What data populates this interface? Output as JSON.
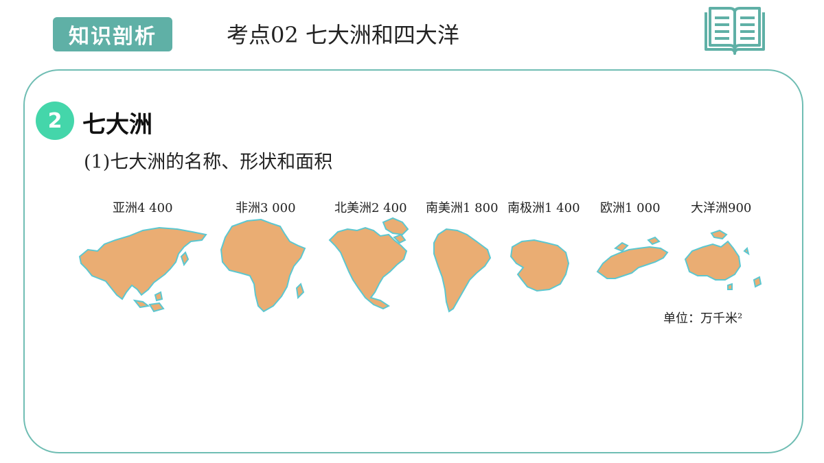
{
  "header": {
    "badge": "知识剖析",
    "title": "考点02  七大洲和四大洋",
    "icon": "book-icon"
  },
  "section": {
    "number": "2",
    "title": "七大洲",
    "subtitle": "(1)七大洲的名称、形状和面积"
  },
  "continents": [
    {
      "label": "亚洲4 400"
    },
    {
      "label": "非洲3 000"
    },
    {
      "label": "北美洲2 400"
    },
    {
      "label": "南美洲1 800"
    },
    {
      "label": "南极洲1 400"
    },
    {
      "label": "欧洲1 000"
    },
    {
      "label": "大洋洲900"
    }
  ],
  "unit": "单位：万千米²",
  "colors": {
    "accent": "#5fb0a6",
    "number_circle": "#44d6aa",
    "land": "#eaad73",
    "coast": "#5cc7d0"
  }
}
